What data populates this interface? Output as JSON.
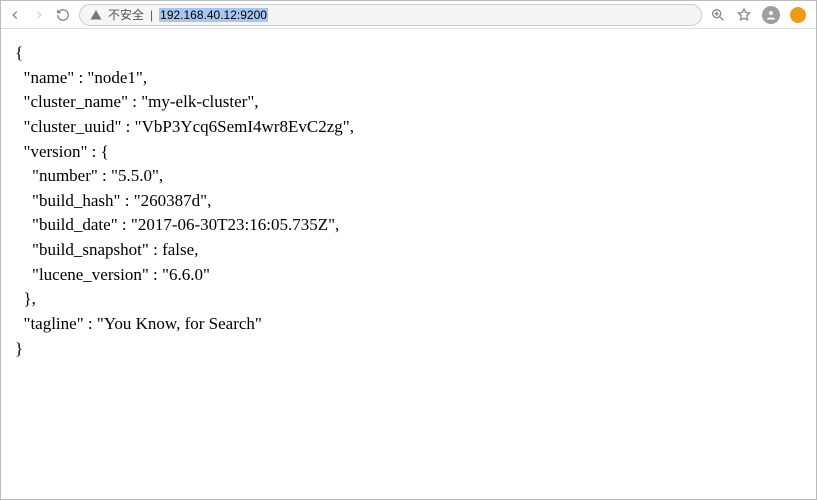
{
  "toolbar": {
    "insecure_label": "不安全",
    "url": "192.168.40.12:9200"
  },
  "json_body": {
    "name": "node1",
    "cluster_name": "my-elk-cluster",
    "cluster_uuid": "VbP3Ycq6SemI4wr8EvC2zg",
    "version": {
      "number": "5.5.0",
      "build_hash": "260387d",
      "build_date": "2017-06-30T23:16:05.735Z",
      "build_snapshot": "false",
      "lucene_version": "6.6.0"
    },
    "tagline": "You Know, for Search"
  }
}
